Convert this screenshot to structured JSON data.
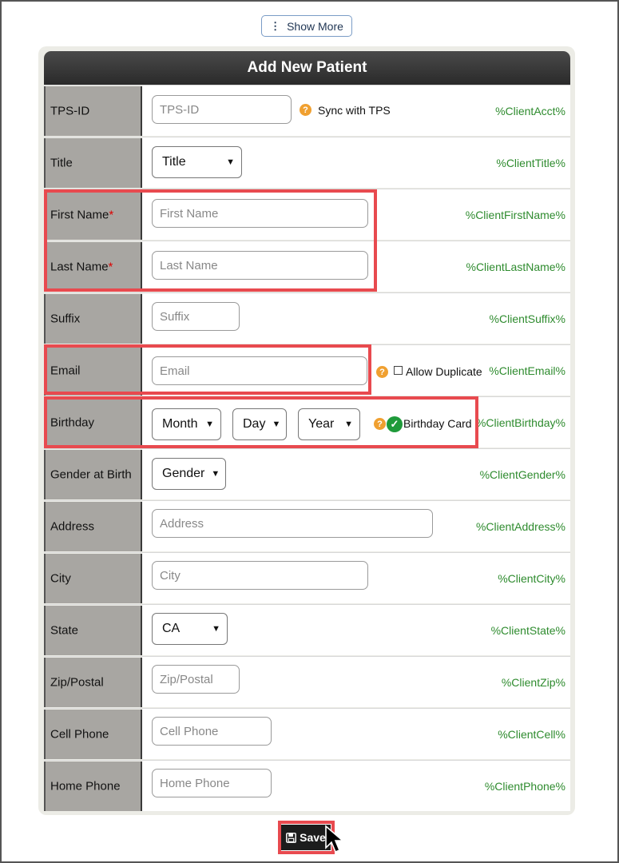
{
  "toolbar": {
    "show_more_label": "Show More",
    "save_label": "Save"
  },
  "form": {
    "title": "Add New Patient",
    "rows": [
      {
        "label": "TPS-ID",
        "placeholder": "TPS-ID",
        "token": "%ClientAcct%",
        "extra": "Sync with TPS"
      },
      {
        "label": "Title",
        "select_value": "Title",
        "token": "%ClientTitle%"
      },
      {
        "label": "First Name",
        "required": "*",
        "placeholder": "First Name",
        "token": "%ClientFirstName%"
      },
      {
        "label": "Last Name",
        "required": "*",
        "placeholder": "Last Name",
        "token": "%ClientLastName%"
      },
      {
        "label": "Suffix",
        "placeholder": "Suffix",
        "token": "%ClientSuffix%"
      },
      {
        "label": "Email",
        "placeholder": "Email",
        "token": "%ClientEmail%",
        "extra": "Allow Duplicate"
      },
      {
        "label": "Birthday",
        "month": "Month",
        "day": "Day",
        "year": "Year",
        "token": "%ClientBirthday%",
        "extra": "Birthday Card"
      },
      {
        "label": "Gender at Birth",
        "select_value": "Gender",
        "token": "%ClientGender%"
      },
      {
        "label": "Address",
        "placeholder": "Address",
        "token": "%ClientAddress%"
      },
      {
        "label": "City",
        "placeholder": "City",
        "token": "%ClientCity%"
      },
      {
        "label": "State",
        "select_value": "CA",
        "token": "%ClientState%"
      },
      {
        "label": "Zip/Postal",
        "placeholder": "Zip/Postal",
        "token": "%ClientZip%"
      },
      {
        "label": "Cell Phone",
        "placeholder": "Cell Phone",
        "token": "%ClientCell%"
      },
      {
        "label": "Home Phone",
        "placeholder": "Home Phone",
        "token": "%ClientPhone%"
      }
    ]
  },
  "colors": {
    "token": "#2e8b2e",
    "highlight": "#e84a4f",
    "help": "#f0a030",
    "check": "#1f9a3a",
    "label_bg": "#a8a6a2"
  },
  "icons": {
    "help": "question-circle-icon",
    "check": "check-circle-icon",
    "save": "floppy-disk-icon",
    "more": "vertical-ellipsis-icon",
    "chevron": "chevron-down-icon",
    "cursor": "mouse-pointer-icon"
  }
}
